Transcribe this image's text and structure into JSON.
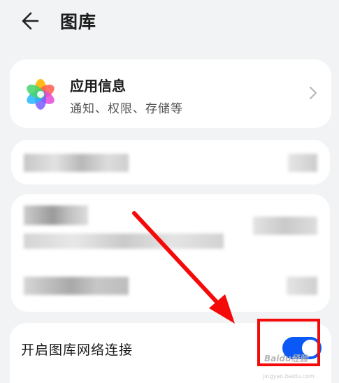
{
  "header": {
    "title": "图库",
    "back_icon": "arrow-left-icon"
  },
  "app_info": {
    "icon": "gallery-flower-icon",
    "title": "应用信息",
    "subtitle": "通知、权限、存储等",
    "chevron_icon": "chevron-right-icon"
  },
  "network_toggle": {
    "label": "开启图库网络连接",
    "state": "on",
    "active_color": "#0a59f7"
  },
  "annotation": {
    "color": "#f50a0a"
  },
  "watermark": {
    "brand": "Baidu经验",
    "url": "jingyan.baidu.com"
  }
}
